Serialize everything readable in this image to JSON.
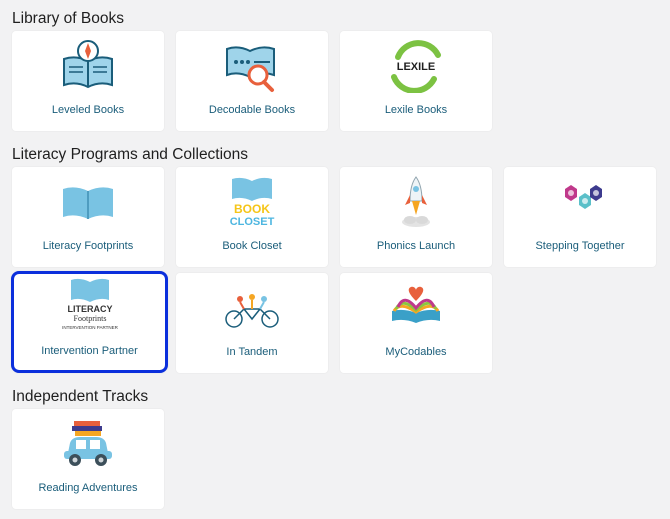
{
  "sections": {
    "library": {
      "title": "Library of Books",
      "cards": [
        {
          "label": "Leveled Books",
          "icon": "book-compass-icon"
        },
        {
          "label": "Decodable Books",
          "icon": "book-magnifier-icon"
        },
        {
          "label": "Lexile Books",
          "icon": "lexile-logo-icon",
          "logo_text": "LEXILE"
        }
      ]
    },
    "literacy": {
      "title": "Literacy Programs and Collections",
      "cards": [
        {
          "label": "Literacy Footprints",
          "icon": "open-book-icon"
        },
        {
          "label": "Book Closet",
          "icon": "book-closet-logo-icon",
          "logo_line1": "BOOK",
          "logo_line2": "CLOSET"
        },
        {
          "label": "Phonics Launch",
          "icon": "rocket-icon"
        },
        {
          "label": "Stepping Together",
          "icon": "hexagons-icon"
        },
        {
          "label": "Intervention Partner",
          "icon": "literacy-footprints-logo-icon",
          "logo_line1": "LITERACY",
          "logo_line2": "Footprints",
          "logo_line3": "INTERVENTION PARTNER"
        },
        {
          "label": "In Tandem",
          "icon": "tandem-bike-icon"
        },
        {
          "label": "MyCodables",
          "icon": "open-book-heart-icon"
        }
      ]
    },
    "independent": {
      "title": "Independent Tracks",
      "cards": [
        {
          "label": "Reading Adventures",
          "icon": "car-books-icon"
        }
      ]
    }
  },
  "colors": {
    "accent_label": "#1a5d7a",
    "selected_border": "#0b2fdc",
    "book_blue": "#79c3e3"
  }
}
